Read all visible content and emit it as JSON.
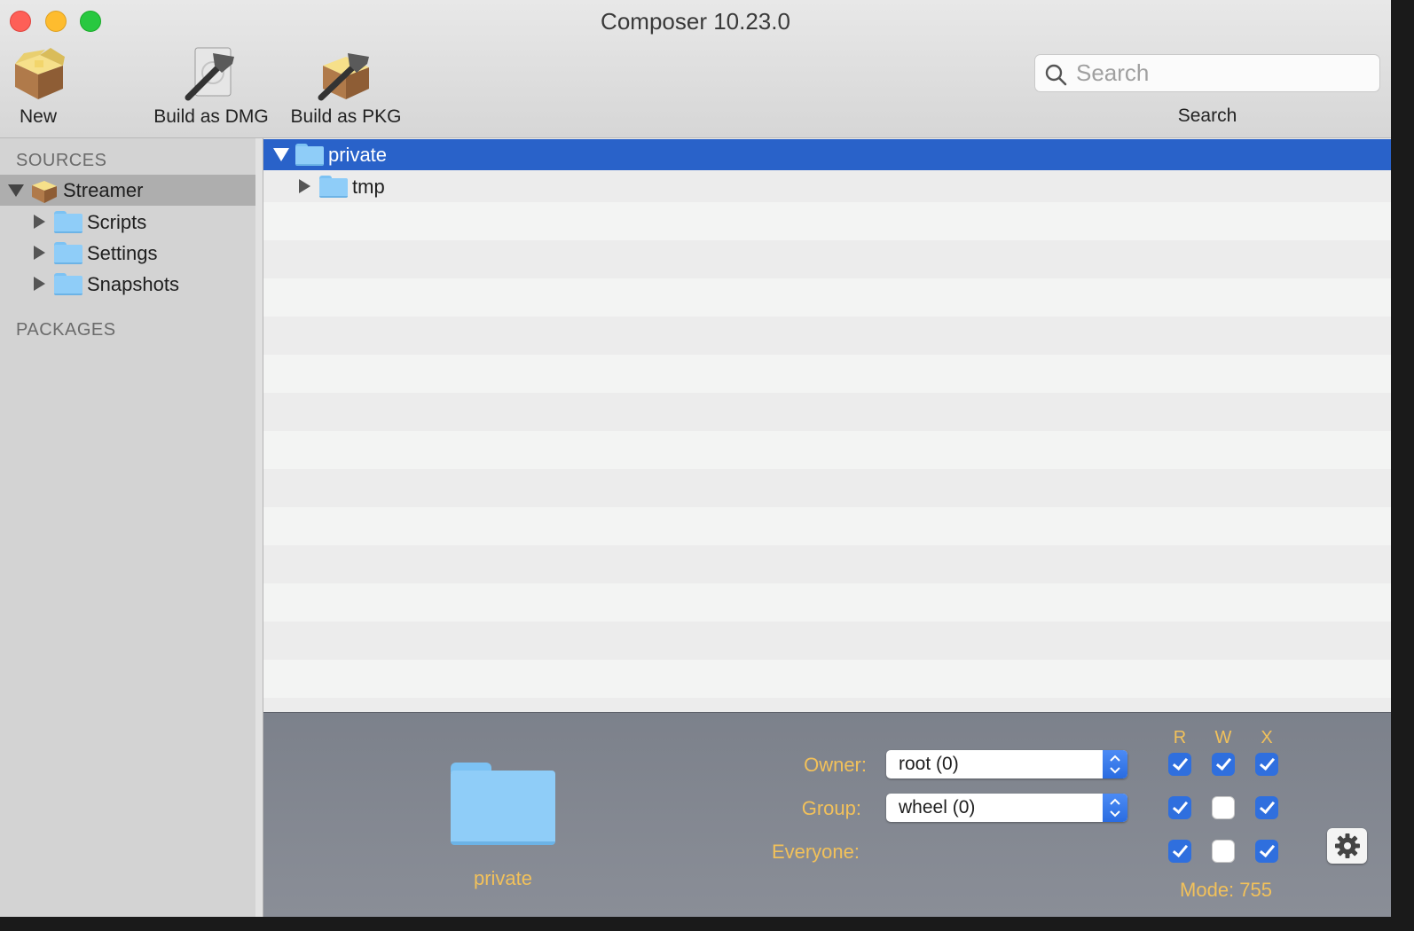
{
  "window": {
    "title": "Composer 10.23.0"
  },
  "toolbar": {
    "new_label": "New",
    "build_dmg_label": "Build as DMG",
    "build_pkg_label": "Build as PKG",
    "search_placeholder": "Search",
    "search_label": "Search"
  },
  "sidebar": {
    "sources_heading": "SOURCES",
    "source_name": "Streamer",
    "items": [
      {
        "label": "Scripts"
      },
      {
        "label": "Settings"
      },
      {
        "label": "Snapshots"
      }
    ],
    "packages_heading": "PACKAGES"
  },
  "list": {
    "rows": [
      {
        "label": "private",
        "expanded": true,
        "selected": true
      },
      {
        "label": "tmp",
        "expanded": false,
        "selected": false
      }
    ]
  },
  "info": {
    "item_name": "private",
    "owner_label": "Owner:",
    "owner_value": "root (0)",
    "group_label": "Group:",
    "group_value": "wheel (0)",
    "everyone_label": "Everyone:",
    "perm_headers": [
      "R",
      "W",
      "X"
    ],
    "permissions": {
      "owner": [
        true,
        true,
        true
      ],
      "group": [
        true,
        false,
        true
      ],
      "everyone": [
        true,
        false,
        true
      ]
    },
    "mode_text": "Mode: 755"
  },
  "colors": {
    "selection": "#2962c9",
    "accent_label": "#f2c15a",
    "checkbox": "#2f6fde"
  }
}
